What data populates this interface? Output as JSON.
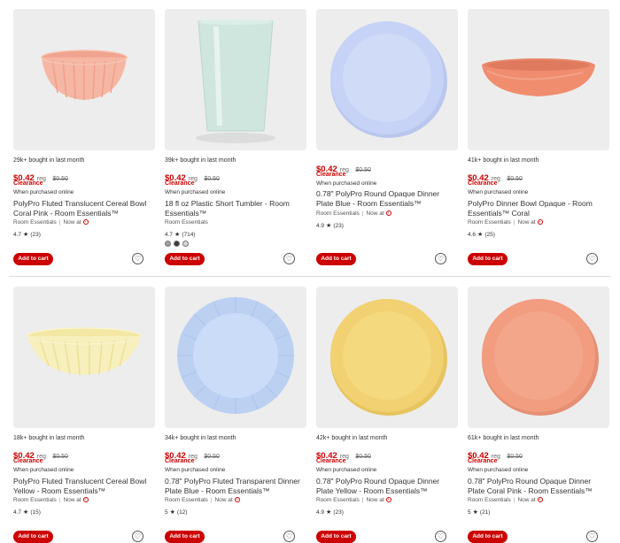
{
  "rows": [
    {
      "cards": [
        {
          "image_name": "coral-fluted-cereal-bowl-image",
          "bought": "29k+ bought in last month",
          "price": "$0.42",
          "reg_prefix": "reg",
          "reg_price": "$0.50",
          "clearance": "Clearance",
          "online": "When purchased online",
          "title": "PolyPro Fluted Translucent Cereal Bowl Coral Pink - Room Essentials™",
          "brand": "Room Essentials",
          "now_at": "Now at",
          "rating": "4.7",
          "reviews": "(23)",
          "add_label": "Add to cart"
        },
        {
          "image_name": "mint-plastic-tumbler-image",
          "bought": "39k+ bought in last month",
          "price": "$0.42",
          "reg_prefix": "reg",
          "reg_price": "$0.50",
          "clearance": "Clearance",
          "online": "When purchased online",
          "title": "18 fl oz Plastic Short Tumbler - Room Essentials™",
          "brand": "Room Essentials",
          "rating": "4.7",
          "reviews": "(714)",
          "swatches": [
            "#a0a0a0",
            "#3a3a3a",
            "#d8d8d8"
          ],
          "add_label": "Add to cart"
        },
        {
          "image_name": "blue-round-dinner-plate-image",
          "bought": "",
          "price": "$0.42",
          "reg_prefix": "reg",
          "reg_price": "$0.50",
          "clearance": "Clearance",
          "online": "When purchased online",
          "title": "0.78\" PolyPro Round Opaque Dinner Plate Blue - Room Essentials™",
          "brand": "Room Essentials",
          "now_at": "Now at",
          "rating": "4.9",
          "reviews": "(23)",
          "add_label": "Add to cart"
        },
        {
          "image_name": "coral-dinner-bowl-image",
          "bought": "41k+ bought in last month",
          "price": "$0.42",
          "reg_prefix": "reg",
          "reg_price": "$0.50",
          "clearance": "Clearance",
          "online": "When purchased online",
          "title": "PolyPro Dinner Bowl Opaque - Room Essentials™ Coral",
          "brand": "Room Essentials",
          "now_at": "Now at",
          "rating": "4.6",
          "reviews": "(25)",
          "add_label": "Add to cart"
        }
      ]
    },
    {
      "cards": [
        {
          "image_name": "yellow-fluted-cereal-bowl-image",
          "bought": "18k+ bought in last month",
          "price": "$0.42",
          "reg_prefix": "reg",
          "reg_price": "$0.50",
          "clearance": "Clearance",
          "online": "When purchased online",
          "title": "PolyPro Fluted Translucent Cereal Bowl Yellow - Room Essentials™",
          "brand": "Room Essentials",
          "now_at": "Now at",
          "rating": "4.7",
          "reviews": "(15)",
          "add_label": "Add to cart"
        },
        {
          "image_name": "blue-fluted-dinner-plate-image",
          "bought": "34k+ bought in last month",
          "price": "$0.42",
          "reg_prefix": "reg",
          "reg_price": "$0.50",
          "clearance": "Clearance",
          "online": "When purchased online",
          "title": "0.78\" PolyPro Fluted Transparent Dinner Plate Blue - Room Essentials™",
          "brand": "Room Essentials",
          "now_at": "Now at",
          "rating": "5",
          "reviews": "(12)",
          "add_label": "Add to cart"
        },
        {
          "image_name": "yellow-round-dinner-plate-image",
          "bought": "42k+ bought in last month",
          "price": "$0.42",
          "reg_prefix": "reg",
          "reg_price": "$0.50",
          "clearance": "Clearance",
          "online": "When purchased online",
          "title": "0.78\" PolyPro Round Opaque Dinner Plate Yellow - Room Essentials™",
          "brand": "Room Essentials",
          "now_at": "Now at",
          "rating": "4.9",
          "reviews": "(23)",
          "add_label": "Add to cart"
        },
        {
          "image_name": "coral-round-dinner-plate-image",
          "bought": "61k+ bought in last month",
          "price": "$0.42",
          "reg_prefix": "reg",
          "reg_price": "$0.50",
          "clearance": "Clearance",
          "online": "When purchased online",
          "title": "0.78\" PolyPro Round Opaque Dinner Plate Coral Pink - Room Essentials™",
          "brand": "Room Essentials",
          "now_at": "Now at",
          "rating": "5",
          "reviews": "(21)",
          "add_label": "Add to cart"
        }
      ]
    }
  ],
  "colors": {
    "accent_red": "#cc0000",
    "image_bg": "#ededed"
  },
  "icons": {
    "favorite": "heart-icon",
    "rating": "star-icon",
    "store": "target-bullseye-icon"
  }
}
